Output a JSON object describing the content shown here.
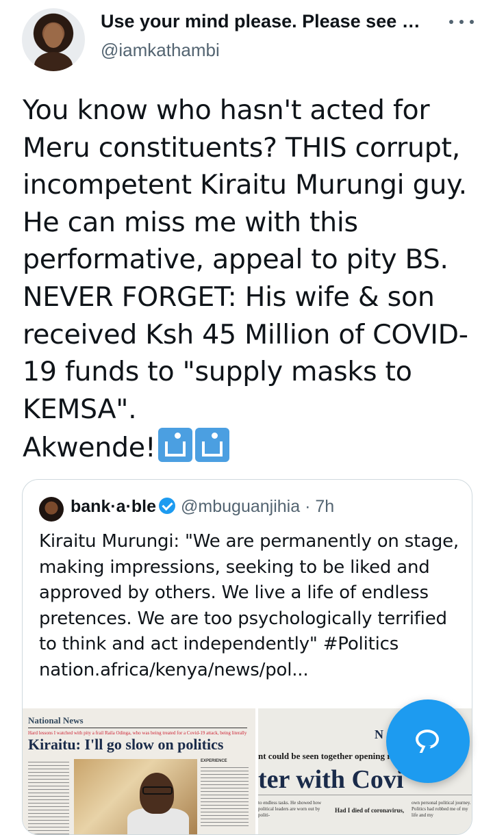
{
  "author": {
    "display_name": "Use your mind please. Please see s...",
    "handle": "@iamkathambi"
  },
  "tweet": {
    "text_main": "You know who hasn't acted for Meru constituents? THIS corrupt, incompetent Kiraitu Murungi guy. He can miss me with this performative, appeal to pity BS. NEVER FORGET: His wife & son received Ksh 45 Million of COVID-19 funds to \"supply masks to KEMSA\".",
    "text_last": "Akwende!",
    "emoji_icons": [
      "put-litter-in-its-place-icon",
      "put-litter-in-its-place-icon"
    ]
  },
  "quoted": {
    "name": "bank·a·ble",
    "handle_time": "@mbuguanjihia · 7h",
    "text": "Kiraitu Murungi: \"We are permanently on stage, making impressions, seeking to be liked and approved by others. We live a life of endless pretences. We are too psychologically terrified to think and act independently\" #Politics nation.africa/kenya/news/pol...",
    "image_left": {
      "section": "National News",
      "kicker": "Hard lessons I watched with pity a frail Raila Odinga, who was being treated for a Covid-19 attack, being literally",
      "headline": "Kiraitu: I'll go slow on politics",
      "side_label": "EXPERIENCE"
    },
    "image_right": {
      "letter": "N",
      "subhead": "nt could be seen together opening roads in",
      "headline": "ter with Covi",
      "col_left": "to endless tasks. He showed how political leaders are worn out by politi-",
      "col_mid": "Had I died of coronavirus,",
      "col_right": "own personal political journey. Politics had robbed me of my life and my"
    }
  },
  "fab": {
    "icon": "compose-reply-icon"
  }
}
